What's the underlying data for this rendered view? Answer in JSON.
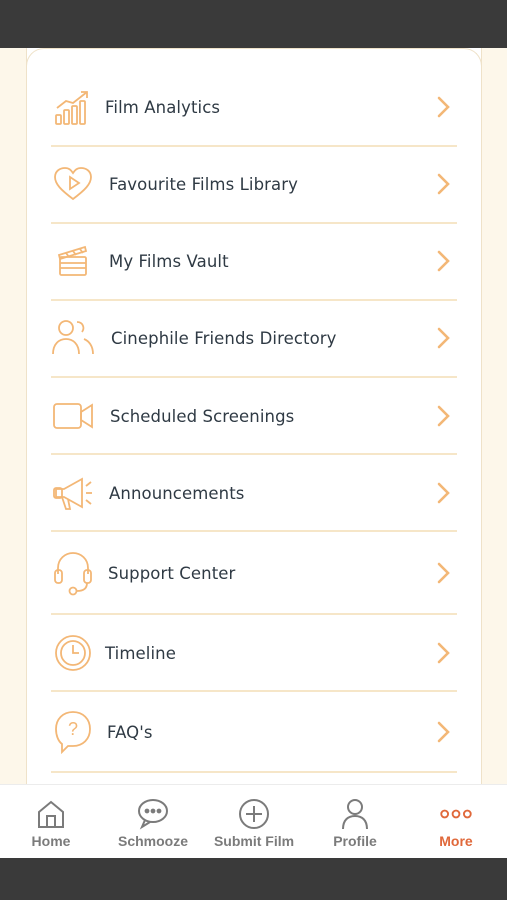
{
  "menu": {
    "items": [
      {
        "label": "Film Analytics",
        "icon": "bar-chart-growth-icon"
      },
      {
        "label": "Favourite Films Library",
        "icon": "heart-play-icon"
      },
      {
        "label": "My Films Vault",
        "icon": "clapperboard-icon"
      },
      {
        "label": "Cinephile Friends Directory",
        "icon": "users-icon"
      },
      {
        "label": "Scheduled Screenings",
        "icon": "video-camera-icon"
      },
      {
        "label": "Announcements",
        "icon": "megaphone-icon"
      },
      {
        "label": "Support Center",
        "icon": "headset-icon"
      },
      {
        "label": "Timeline",
        "icon": "clock-icon"
      },
      {
        "label": "FAQ's",
        "icon": "question-bubble-icon"
      }
    ]
  },
  "nav": {
    "home": "Home",
    "schmooze": "Schmooze",
    "submit": "Submit Film",
    "profile": "Profile",
    "more": "More"
  },
  "colors": {
    "accent": "#f3b776",
    "active": "#e0683a",
    "text": "#2f3a44",
    "background": "#fdf7ea"
  }
}
